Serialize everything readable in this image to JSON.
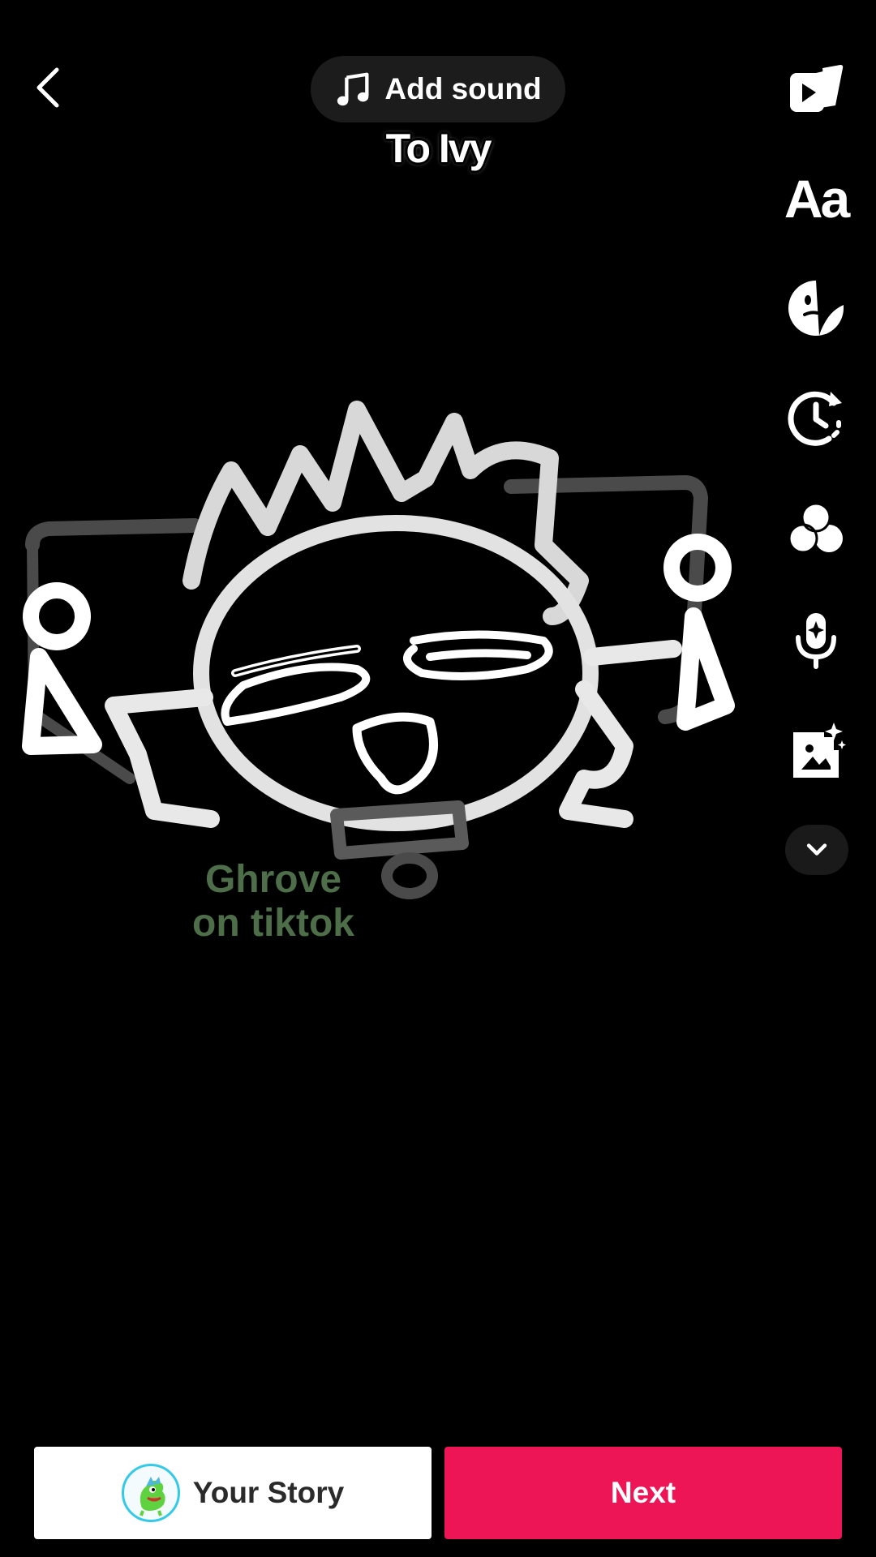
{
  "header": {
    "add_sound_label": "Add sound",
    "caption": "To Ivy"
  },
  "toolbar": {
    "items": [
      "templates-icon",
      "text-icon",
      "sticker-icon",
      "timer-icon",
      "effects-icon",
      "voice-effects-icon",
      "image-icon"
    ],
    "text_tool_label": "Aa",
    "more_icon": "chevron-down-icon"
  },
  "canvas": {
    "watermark": "Ghrove\non tiktok",
    "watermark_color": "#4e6e4a"
  },
  "footer": {
    "story_label": "Your Story",
    "next_label": "Next",
    "next_color": "#ee1556"
  }
}
